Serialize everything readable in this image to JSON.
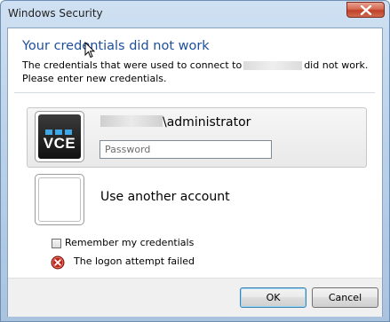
{
  "window": {
    "title": "Windows Security"
  },
  "dialog": {
    "heading": "Your credentials did not work",
    "description_part1": "The credentials that were used to connect to",
    "description_part2": "did not work.",
    "description_line2": "Please enter new credentials."
  },
  "credential_tile": {
    "icon_text": "VCE",
    "username_suffix": "\\administrator",
    "password_placeholder": "Password"
  },
  "another_account": {
    "label": "Use another account"
  },
  "options": {
    "remember_label": "Remember my credentials",
    "remember_checked": false
  },
  "status": {
    "error_text": "The logon attempt failed"
  },
  "buttons": {
    "ok": "OK",
    "cancel": "Cancel"
  },
  "colors": {
    "heading": "#1d4f9a",
    "error_red": "#c0281c",
    "vce_accent": "#3ea7e8"
  }
}
